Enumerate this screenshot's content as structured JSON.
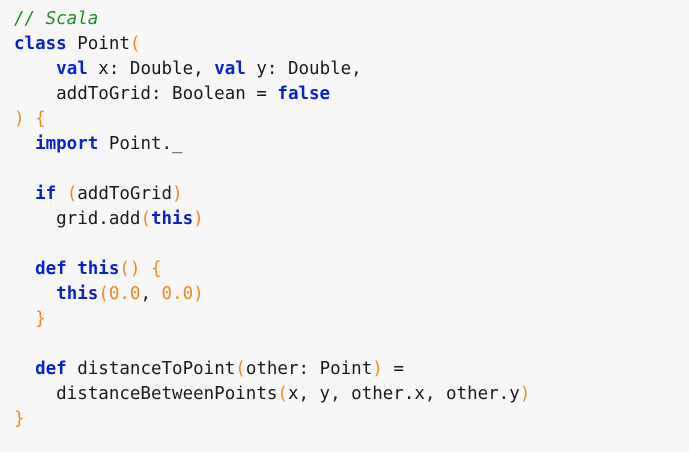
{
  "code": {
    "language": "Scala",
    "colors": {
      "background": "#f7f7f7",
      "comment": "#1f8a28",
      "keyword": "#0a23c8",
      "punctuation": "#f0891f",
      "number": "#f0891f",
      "text": "#1a1a1a"
    },
    "lines": [
      [
        {
          "t": "comment",
          "s": "// Scala"
        }
      ],
      [
        {
          "t": "keyword",
          "s": "class"
        },
        {
          "t": "plain",
          "s": " Point"
        },
        {
          "t": "punct",
          "s": "("
        }
      ],
      [
        {
          "t": "plain",
          "s": "    "
        },
        {
          "t": "keyword",
          "s": "val"
        },
        {
          "t": "plain",
          "s": " x: Double, "
        },
        {
          "t": "keyword",
          "s": "val"
        },
        {
          "t": "plain",
          "s": " y: Double,"
        }
      ],
      [
        {
          "t": "plain",
          "s": "    addToGrid: Boolean = "
        },
        {
          "t": "keyword",
          "s": "false"
        }
      ],
      [
        {
          "t": "punct",
          "s": ") {"
        }
      ],
      [
        {
          "t": "plain",
          "s": "  "
        },
        {
          "t": "keyword",
          "s": "import"
        },
        {
          "t": "plain",
          "s": " Point._"
        }
      ],
      [],
      [
        {
          "t": "plain",
          "s": "  "
        },
        {
          "t": "keyword",
          "s": "if"
        },
        {
          "t": "plain",
          "s": " "
        },
        {
          "t": "punct",
          "s": "("
        },
        {
          "t": "plain",
          "s": "addToGrid"
        },
        {
          "t": "punct",
          "s": ")"
        }
      ],
      [
        {
          "t": "plain",
          "s": "    grid.add"
        },
        {
          "t": "punct",
          "s": "("
        },
        {
          "t": "keyword",
          "s": "this"
        },
        {
          "t": "punct",
          "s": ")"
        }
      ],
      [],
      [
        {
          "t": "plain",
          "s": "  "
        },
        {
          "t": "keyword",
          "s": "def"
        },
        {
          "t": "plain",
          "s": " "
        },
        {
          "t": "keyword",
          "s": "this"
        },
        {
          "t": "punct",
          "s": "() {"
        }
      ],
      [
        {
          "t": "plain",
          "s": "    "
        },
        {
          "t": "keyword",
          "s": "this"
        },
        {
          "t": "punct",
          "s": "("
        },
        {
          "t": "number",
          "s": "0.0"
        },
        {
          "t": "plain",
          "s": ", "
        },
        {
          "t": "number",
          "s": "0.0"
        },
        {
          "t": "punct",
          "s": ")"
        }
      ],
      [
        {
          "t": "plain",
          "s": "  "
        },
        {
          "t": "punct",
          "s": "}"
        }
      ],
      [],
      [
        {
          "t": "plain",
          "s": "  "
        },
        {
          "t": "keyword",
          "s": "def"
        },
        {
          "t": "plain",
          "s": " distanceToPoint"
        },
        {
          "t": "punct",
          "s": "("
        },
        {
          "t": "plain",
          "s": "other: Point"
        },
        {
          "t": "punct",
          "s": ")"
        },
        {
          "t": "plain",
          "s": " ="
        }
      ],
      [
        {
          "t": "plain",
          "s": "    distanceBetweenPoints"
        },
        {
          "t": "punct",
          "s": "("
        },
        {
          "t": "plain",
          "s": "x, y, other.x, other.y"
        },
        {
          "t": "punct",
          "s": ")"
        }
      ],
      [
        {
          "t": "punct",
          "s": "}"
        }
      ]
    ]
  }
}
